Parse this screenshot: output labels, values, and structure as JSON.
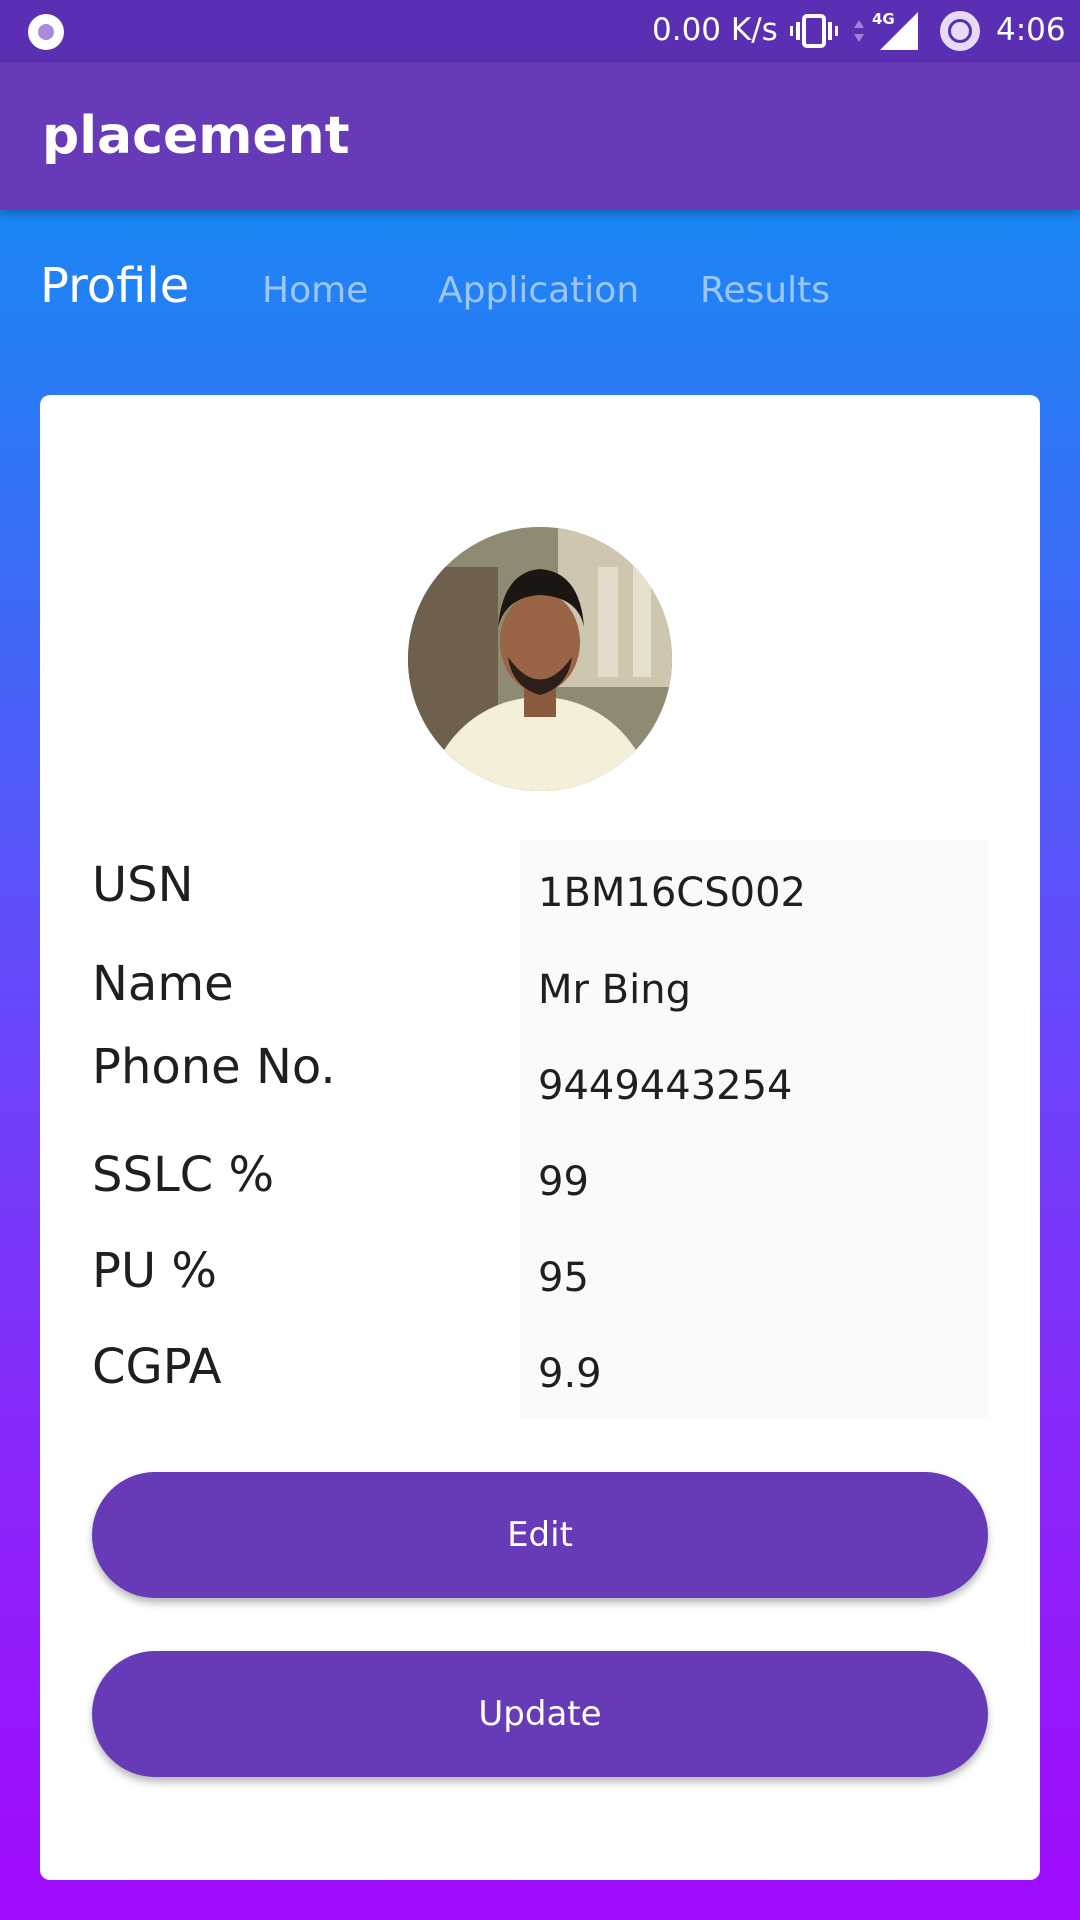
{
  "status_bar": {
    "speed": "0.00 K/s",
    "network": "4G",
    "time": "4:06"
  },
  "app_bar": {
    "title": "placement"
  },
  "tabs": [
    {
      "label": "Profile",
      "active": true
    },
    {
      "label": "Home",
      "active": false
    },
    {
      "label": "Application",
      "active": false
    },
    {
      "label": "Results",
      "active": false
    }
  ],
  "profile": {
    "fields": [
      {
        "label": "USN",
        "value": "1BM16CS002"
      },
      {
        "label": "Name",
        "value": "Mr Bing"
      },
      {
        "label": "Phone No.",
        "value": "9449443254"
      },
      {
        "label": "SSLC %",
        "value": "99"
      },
      {
        "label": "PU %",
        "value": "95"
      },
      {
        "label": "CGPA",
        "value": "9.9"
      }
    ],
    "edit_label": "Edit",
    "update_label": "Update"
  },
  "colors": {
    "app_bar": "#673ab7",
    "status_bar": "#5a2fb3",
    "gradient_top": "#0895f3",
    "gradient_bottom": "#a10bfd",
    "button": "#673ab7"
  }
}
